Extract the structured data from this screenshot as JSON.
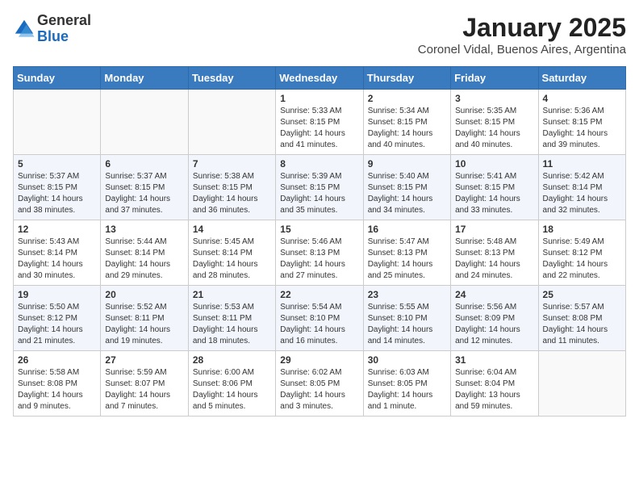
{
  "header": {
    "logo_general": "General",
    "logo_blue": "Blue",
    "month_title": "January 2025",
    "subtitle": "Coronel Vidal, Buenos Aires, Argentina"
  },
  "days_of_week": [
    "Sunday",
    "Monday",
    "Tuesday",
    "Wednesday",
    "Thursday",
    "Friday",
    "Saturday"
  ],
  "weeks": [
    [
      {
        "day": "",
        "info": ""
      },
      {
        "day": "",
        "info": ""
      },
      {
        "day": "",
        "info": ""
      },
      {
        "day": "1",
        "info": "Sunrise: 5:33 AM\nSunset: 8:15 PM\nDaylight: 14 hours\nand 41 minutes."
      },
      {
        "day": "2",
        "info": "Sunrise: 5:34 AM\nSunset: 8:15 PM\nDaylight: 14 hours\nand 40 minutes."
      },
      {
        "day": "3",
        "info": "Sunrise: 5:35 AM\nSunset: 8:15 PM\nDaylight: 14 hours\nand 40 minutes."
      },
      {
        "day": "4",
        "info": "Sunrise: 5:36 AM\nSunset: 8:15 PM\nDaylight: 14 hours\nand 39 minutes."
      }
    ],
    [
      {
        "day": "5",
        "info": "Sunrise: 5:37 AM\nSunset: 8:15 PM\nDaylight: 14 hours\nand 38 minutes."
      },
      {
        "day": "6",
        "info": "Sunrise: 5:37 AM\nSunset: 8:15 PM\nDaylight: 14 hours\nand 37 minutes."
      },
      {
        "day": "7",
        "info": "Sunrise: 5:38 AM\nSunset: 8:15 PM\nDaylight: 14 hours\nand 36 minutes."
      },
      {
        "day": "8",
        "info": "Sunrise: 5:39 AM\nSunset: 8:15 PM\nDaylight: 14 hours\nand 35 minutes."
      },
      {
        "day": "9",
        "info": "Sunrise: 5:40 AM\nSunset: 8:15 PM\nDaylight: 14 hours\nand 34 minutes."
      },
      {
        "day": "10",
        "info": "Sunrise: 5:41 AM\nSunset: 8:15 PM\nDaylight: 14 hours\nand 33 minutes."
      },
      {
        "day": "11",
        "info": "Sunrise: 5:42 AM\nSunset: 8:14 PM\nDaylight: 14 hours\nand 32 minutes."
      }
    ],
    [
      {
        "day": "12",
        "info": "Sunrise: 5:43 AM\nSunset: 8:14 PM\nDaylight: 14 hours\nand 30 minutes."
      },
      {
        "day": "13",
        "info": "Sunrise: 5:44 AM\nSunset: 8:14 PM\nDaylight: 14 hours\nand 29 minutes."
      },
      {
        "day": "14",
        "info": "Sunrise: 5:45 AM\nSunset: 8:14 PM\nDaylight: 14 hours\nand 28 minutes."
      },
      {
        "day": "15",
        "info": "Sunrise: 5:46 AM\nSunset: 8:13 PM\nDaylight: 14 hours\nand 27 minutes."
      },
      {
        "day": "16",
        "info": "Sunrise: 5:47 AM\nSunset: 8:13 PM\nDaylight: 14 hours\nand 25 minutes."
      },
      {
        "day": "17",
        "info": "Sunrise: 5:48 AM\nSunset: 8:13 PM\nDaylight: 14 hours\nand 24 minutes."
      },
      {
        "day": "18",
        "info": "Sunrise: 5:49 AM\nSunset: 8:12 PM\nDaylight: 14 hours\nand 22 minutes."
      }
    ],
    [
      {
        "day": "19",
        "info": "Sunrise: 5:50 AM\nSunset: 8:12 PM\nDaylight: 14 hours\nand 21 minutes."
      },
      {
        "day": "20",
        "info": "Sunrise: 5:52 AM\nSunset: 8:11 PM\nDaylight: 14 hours\nand 19 minutes."
      },
      {
        "day": "21",
        "info": "Sunrise: 5:53 AM\nSunset: 8:11 PM\nDaylight: 14 hours\nand 18 minutes."
      },
      {
        "day": "22",
        "info": "Sunrise: 5:54 AM\nSunset: 8:10 PM\nDaylight: 14 hours\nand 16 minutes."
      },
      {
        "day": "23",
        "info": "Sunrise: 5:55 AM\nSunset: 8:10 PM\nDaylight: 14 hours\nand 14 minutes."
      },
      {
        "day": "24",
        "info": "Sunrise: 5:56 AM\nSunset: 8:09 PM\nDaylight: 14 hours\nand 12 minutes."
      },
      {
        "day": "25",
        "info": "Sunrise: 5:57 AM\nSunset: 8:08 PM\nDaylight: 14 hours\nand 11 minutes."
      }
    ],
    [
      {
        "day": "26",
        "info": "Sunrise: 5:58 AM\nSunset: 8:08 PM\nDaylight: 14 hours\nand 9 minutes."
      },
      {
        "day": "27",
        "info": "Sunrise: 5:59 AM\nSunset: 8:07 PM\nDaylight: 14 hours\nand 7 minutes."
      },
      {
        "day": "28",
        "info": "Sunrise: 6:00 AM\nSunset: 8:06 PM\nDaylight: 14 hours\nand 5 minutes."
      },
      {
        "day": "29",
        "info": "Sunrise: 6:02 AM\nSunset: 8:05 PM\nDaylight: 14 hours\nand 3 minutes."
      },
      {
        "day": "30",
        "info": "Sunrise: 6:03 AM\nSunset: 8:05 PM\nDaylight: 14 hours\nand 1 minute."
      },
      {
        "day": "31",
        "info": "Sunrise: 6:04 AM\nSunset: 8:04 PM\nDaylight: 13 hours\nand 59 minutes."
      },
      {
        "day": "",
        "info": ""
      }
    ]
  ]
}
